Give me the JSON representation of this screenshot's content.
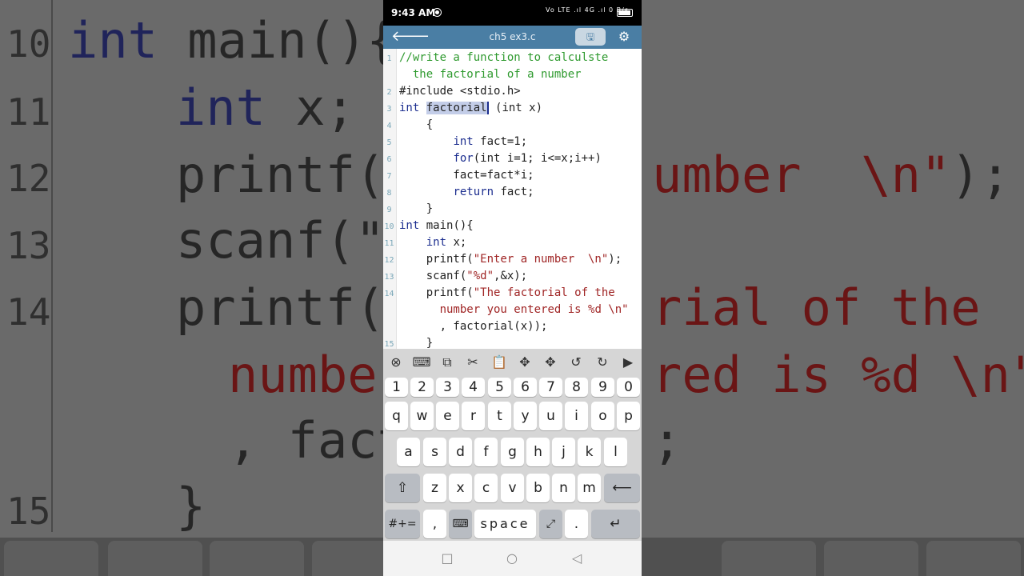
{
  "status_bar": {
    "time": "9:43 AM",
    "signal_text": "Vo LTE .ıl 4G .ıl 0 B/s"
  },
  "toolbar": {
    "back_icon": "arrow-left-icon",
    "title": "ch5 ex3.c",
    "save_icon": "save-icon",
    "settings_icon": "gear-icon"
  },
  "editor": {
    "line_numbers": [
      "1",
      "2",
      "3",
      "4",
      "5",
      "6",
      "7",
      "8",
      "9",
      "10",
      "11",
      "12",
      "13",
      "14",
      "15"
    ],
    "code": {
      "l1a": "//write a function to calculste",
      "l1b": "  the factorial of a number",
      "l2": "#include <stdio.h>",
      "l3_int": "int",
      "l3_sel": "factorial",
      "l3_rest": " (int x)",
      "l4": "    {",
      "l5_int": "int",
      "l5_rest": " fact=1;",
      "l6_for": "for",
      "l6_rest": "(int i=1; i<=x;i++)",
      "l7": "        fact=fact*i;",
      "l8_ret": "return",
      "l8_rest": " fact;",
      "l9": "    }",
      "l10_int": "int",
      "l10_rest": " main(){",
      "l11_int": "int",
      "l11_rest": " x;",
      "l12_pre": "    printf(",
      "l12_str": "\"Enter a number  \\n\"",
      "l12_post": ");",
      "l13_pre": "    scanf(",
      "l13_str": "\"%d\"",
      "l13_post": ",&x);",
      "l14_pre": "    printf(",
      "l14_str": "\"The factorial of the",
      "l14b_str": "number you entered is %d \\n\"",
      "l14c": "      , factorial(x));",
      "l15": "    }"
    }
  },
  "background_zoom": {
    "lines": [
      {
        "num": "10",
        "int": "int",
        "rest": " main(){"
      },
      {
        "num": "11",
        "int": "int",
        "rest": " x;"
      },
      {
        "num": "12",
        "pre": "printf(\"",
        "str": "umber  \\n\"",
        "post": ");"
      },
      {
        "num": "13",
        "pre": "scanf(\"%",
        "str": "",
        "post": ""
      },
      {
        "num": "14",
        "pre": "printf(\"",
        "str": "rial of the",
        "post": ""
      },
      {
        "num": "",
        "str_a": "number",
        "str_b": "red is %d \\n\""
      },
      {
        "num": "",
        "pre": ", fact",
        "post": ";"
      },
      {
        "num": "15",
        "pre": "}"
      }
    ]
  },
  "accessory_bar": {
    "icons": [
      "close-circle-icon",
      "keyboard-icon",
      "copy-icon",
      "cut-icon",
      "paste-icon",
      "move-icon",
      "move-icon",
      "undo-icon",
      "redo-icon",
      "run-icon"
    ]
  },
  "keyboard": {
    "row_numbers": [
      "1",
      "2",
      "3",
      "4",
      "5",
      "6",
      "7",
      "8",
      "9",
      "0"
    ],
    "row_q": [
      "q",
      "w",
      "e",
      "r",
      "t",
      "y",
      "u",
      "i",
      "o",
      "p"
    ],
    "row_a": [
      "a",
      "s",
      "d",
      "f",
      "g",
      "h",
      "j",
      "k",
      "l"
    ],
    "row_z": [
      "z",
      "x",
      "c",
      "v",
      "b",
      "n",
      "m"
    ],
    "symbols_label": "#+=",
    "comma": ",",
    "space_label": "space",
    "period": "."
  },
  "nav_bar": {
    "icons": [
      "recents-square-icon",
      "home-circle-icon",
      "back-triangle-icon"
    ]
  }
}
